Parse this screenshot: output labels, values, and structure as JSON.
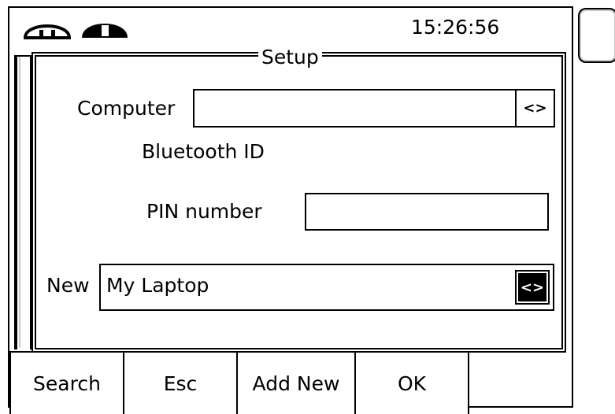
{
  "status_bar": {
    "time": "15:26:56",
    "icons": [
      "socket-outline-icon",
      "socket-filled-icon"
    ]
  },
  "dialog": {
    "title": "Setup",
    "computer_label": "Computer",
    "computer_value": "",
    "computer_spin": "<>",
    "bluetooth_id_label": "Bluetooth ID",
    "pin_label": "PIN number",
    "pin_value": "",
    "new_label": "New",
    "new_value": "My Laptop",
    "new_spin": "<>"
  },
  "softkeys": {
    "search": "Search",
    "esc": "Esc",
    "add_new": "Add New",
    "ok": "OK"
  }
}
